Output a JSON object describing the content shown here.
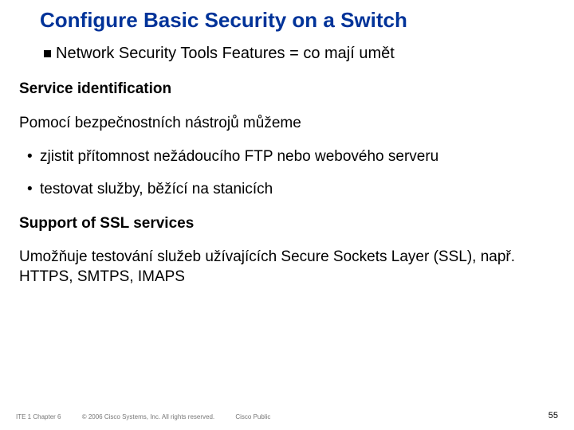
{
  "title": "Configure Basic Security on a Switch",
  "subtitle": "Network Security Tools Features = co mají umět",
  "section1_heading": "Service identification",
  "section1_intro": "Pomocí bezpečnostních nástrojů můžeme",
  "section1_bullets": [
    "zjistit přítomnost nežádoucího FTP nebo webového serveru",
    "testovat služby, běžící na stanicích"
  ],
  "section2_heading": "Support of SSL services",
  "section2_body": "Umožňuje testování služeb užívajících Secure Sockets Layer (SSL), např. HTTPS, SMTPS, IMAPS",
  "footer": {
    "left": "ITE 1 Chapter 6",
    "copyright": "© 2006 Cisco Systems, Inc. All rights reserved.",
    "public": "Cisco Public",
    "page": "55"
  }
}
